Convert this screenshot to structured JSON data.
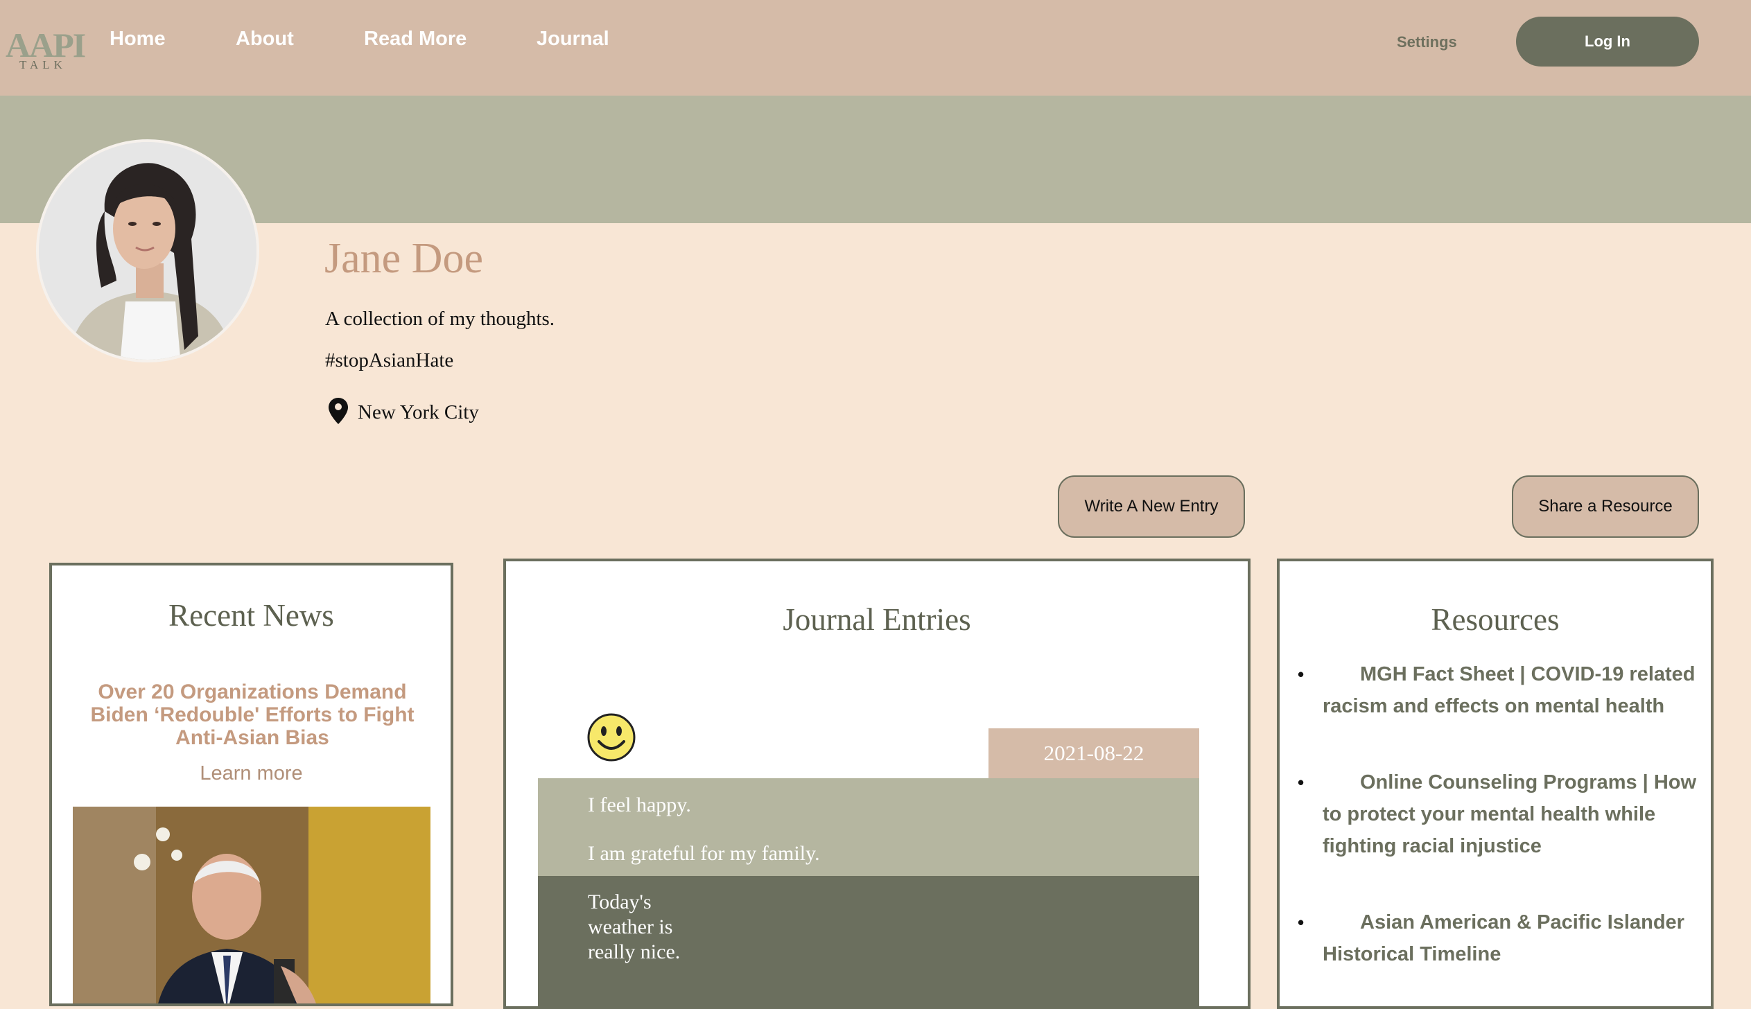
{
  "nav": {
    "logo_main": "AAPI",
    "logo_sub": "TALK",
    "links": [
      "Home",
      "About",
      "Read More",
      "Journal"
    ],
    "settings": "Settings",
    "login": "Log In"
  },
  "profile": {
    "name": "Jane Doe",
    "bio": "A collection of my thoughts.",
    "hashtag": "#stopAsianHate",
    "location": "New York City"
  },
  "actions": {
    "write_entry": "Write A New Entry",
    "share_resource": "Share a Resource"
  },
  "news": {
    "title": "Recent News",
    "headline": "Over 20 Organizations Demand Biden ‘Redouble' Efforts to Fight Anti-Asian Bias",
    "learn_more": "Learn more"
  },
  "journal": {
    "title": "Journal Entries",
    "mood_icon": "smiley-face-icon",
    "entry": {
      "date": "2021-08-22",
      "feeling": "I feel happy.",
      "gratitude": "I am grateful for my family.",
      "note": "Today's weather is really nice."
    }
  },
  "resources": {
    "title": "Resources",
    "items": [
      "MGH Fact Sheet | COVID-19 related racism and effects on mental health",
      "Online Counseling Programs | How to protect your mental health while fighting racial injustice",
      "Asian American & Pacific Islander Historical Timeline"
    ]
  },
  "colors": {
    "nav_bg": "#d5bba8",
    "banner": "#b5b6a0",
    "page_bg": "#f8e6d5",
    "accent_dark": "#6b6f5e",
    "accent_text": "#c49a7f"
  }
}
